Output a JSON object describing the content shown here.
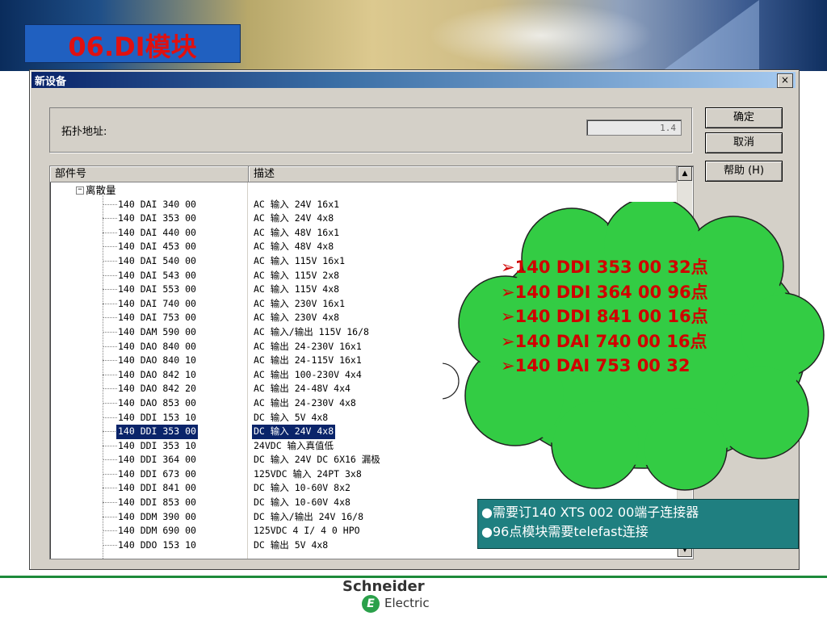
{
  "slide": {
    "title": "06.DI模块"
  },
  "dialog": {
    "title": "新设备",
    "close_label": "×",
    "topo_label": "拓扑地址:",
    "topo_value": "1.4",
    "buttons": {
      "ok": "确定",
      "cancel": "取消",
      "help": "帮助 (H)"
    },
    "columns": {
      "part_no": "部件号",
      "description": "描述"
    },
    "group_name": "离散量",
    "expander": "−",
    "rows": [
      {
        "part": "140 DAI 340 00",
        "desc": "AC 输入 24V 16x1"
      },
      {
        "part": "140 DAI 353 00",
        "desc": "AC 输入 24V 4x8"
      },
      {
        "part": "140 DAI 440 00",
        "desc": "AC 输入 48V 16x1"
      },
      {
        "part": "140 DAI 453 00",
        "desc": "AC 输入 48V 4x8"
      },
      {
        "part": "140 DAI 540 00",
        "desc": "AC 输入 115V 16x1"
      },
      {
        "part": "140 DAI 543 00",
        "desc": "AC 输入 115V 2x8"
      },
      {
        "part": "140 DAI 553 00",
        "desc": "AC 输入 115V 4x8"
      },
      {
        "part": "140 DAI 740 00",
        "desc": "AC 输入 230V 16x1"
      },
      {
        "part": "140 DAI 753 00",
        "desc": "AC 输入 230V 4x8"
      },
      {
        "part": "140 DAM 590 00",
        "desc": "AC 输入/输出 115V 16/8"
      },
      {
        "part": "140 DAO 840 00",
        "desc": "AC 输出 24-230V 16x1"
      },
      {
        "part": "140 DAO 840 10",
        "desc": "AC 输出 24-115V 16x1"
      },
      {
        "part": "140 DAO 842 10",
        "desc": "AC 输出 100-230V 4x4"
      },
      {
        "part": "140 DAO 842 20",
        "desc": "AC 输出 24-48V 4x4"
      },
      {
        "part": "140 DAO 853 00",
        "desc": "AC 输出 24-230V 4x8"
      },
      {
        "part": "140 DDI 153 10",
        "desc": "DC 输入 5V 4x8"
      },
      {
        "part": "140 DDI 353 00",
        "desc": "DC 输入 24V 4x8",
        "selected": true
      },
      {
        "part": "140 DDI 353 10",
        "desc": "24VDC 输入真值低"
      },
      {
        "part": "140 DDI 364 00",
        "desc": "DC 输入 24V DC 6X16 漏极"
      },
      {
        "part": "140 DDI 673 00",
        "desc": "125VDC 输入 24PT 3x8"
      },
      {
        "part": "140 DDI 841 00",
        "desc": "DC 输入 10-60V 8x2"
      },
      {
        "part": "140 DDI 853 00",
        "desc": "DC 输入 10-60V 4x8"
      },
      {
        "part": "140 DDM 390 00",
        "desc": "DC 输入/输出 24V 16/8"
      },
      {
        "part": "140 DDM 690 00",
        "desc": "125VDC 4 I/ 4 0 HPO"
      },
      {
        "part": "140 DDO 153 10",
        "desc": "DC 输出 5V 4x8"
      }
    ],
    "scroll_up": "▲",
    "scroll_down": "▼"
  },
  "callout": {
    "items": [
      "➢140 DDI 353 00  32点",
      "➢140 DDI 364 00  96点",
      "➢140 DDI 841 00  16点",
      "➢140 DAI 740 00  16点",
      "➢140 DAI 753 00  32"
    ],
    "notes": [
      "●需要订140 XTS 002 00端子连接器",
      "●96点模块需要telefast连接"
    ]
  },
  "logo": {
    "line1": "Schneider",
    "line2": "Electric",
    "mark": "E"
  },
  "colors": {
    "title_red": "#e01010",
    "selection": "#0a246a",
    "callout_red": "#d00000",
    "note_teal": "#1f7f80",
    "brand_green": "#2aa04a"
  }
}
